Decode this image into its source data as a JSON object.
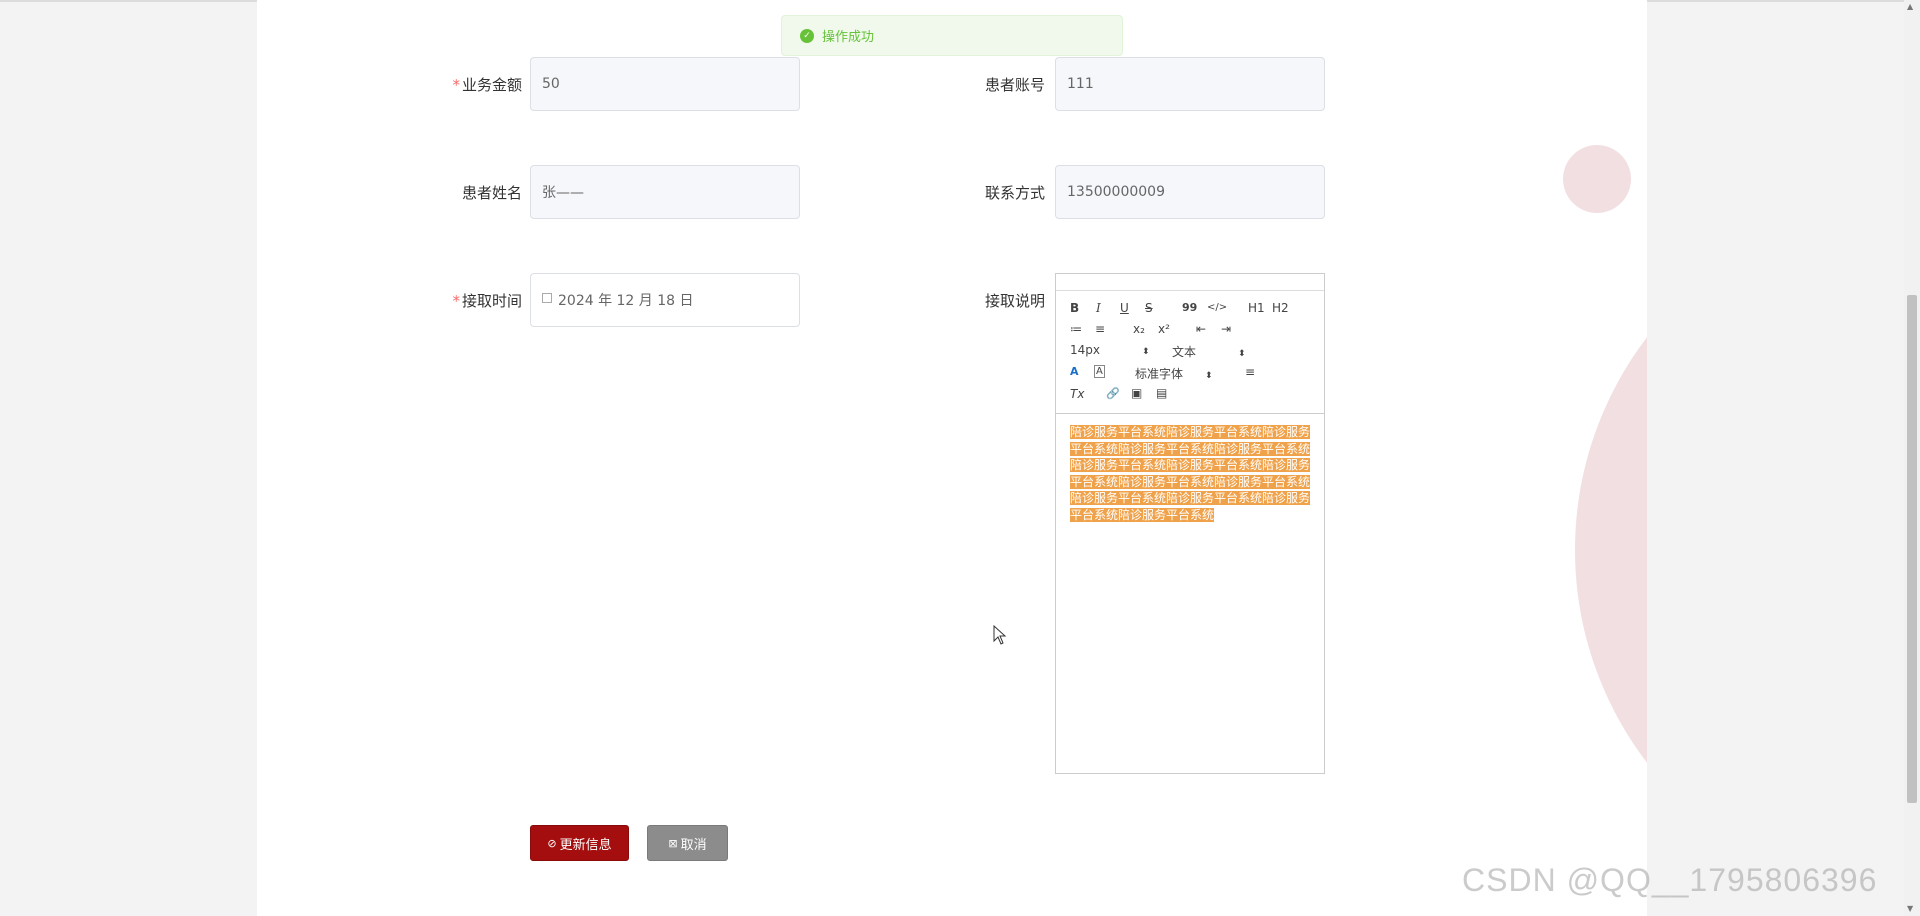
{
  "toast": {
    "message": "操作成功",
    "icon": "check-circle-icon",
    "color": "#67c23a"
  },
  "form": {
    "amount": {
      "label": "业务金额",
      "required": "*",
      "value": "50"
    },
    "account": {
      "label": "患者账号",
      "value": "111"
    },
    "name": {
      "label": "患者姓名",
      "value": "张——"
    },
    "contact": {
      "label": "联系方式",
      "value": "13500000009"
    },
    "time": {
      "label": "接取时间",
      "required": "*",
      "value": "2024 年 12 月 18 日"
    },
    "desc": {
      "label": "接取说明"
    }
  },
  "editor": {
    "toolbar": {
      "bold": "B",
      "italic": "I",
      "underline": "U",
      "strike": "S",
      "blockquote": "99",
      "code": "</>",
      "h1": "H1",
      "h2": "H2",
      "ordered_list": "≔",
      "bullet_list": "≡",
      "subscript": "x₂",
      "superscript": "x²",
      "outdent": "⇤",
      "indent": "⇥",
      "size_select": "14px",
      "header_select": "文本",
      "color": "A",
      "background": "A",
      "font_select": "标准字体",
      "align": "≡",
      "clean": "Tx",
      "link": "🔗",
      "image": "▣",
      "video": "▤"
    },
    "content": "陪诊服务平台系统陪诊服务平台系统陪诊服务平台系统陪诊服务平台系统陪诊服务平台系统陪诊服务平台系统陪诊服务平台系统陪诊服务平台系统陪诊服务平台系统陪诊服务平台系统陪诊服务平台系统陪诊服务平台系统陪诊服务平台系统陪诊服务平台系统",
    "highlight_color": "#f0a24a"
  },
  "buttons": {
    "update": "更新信息",
    "update_icon": "circle-check-icon",
    "cancel": "取消",
    "cancel_icon": "close-box-icon",
    "primary_color": "#a40e0e"
  },
  "watermark": "CSDN @QQ__1795806396"
}
